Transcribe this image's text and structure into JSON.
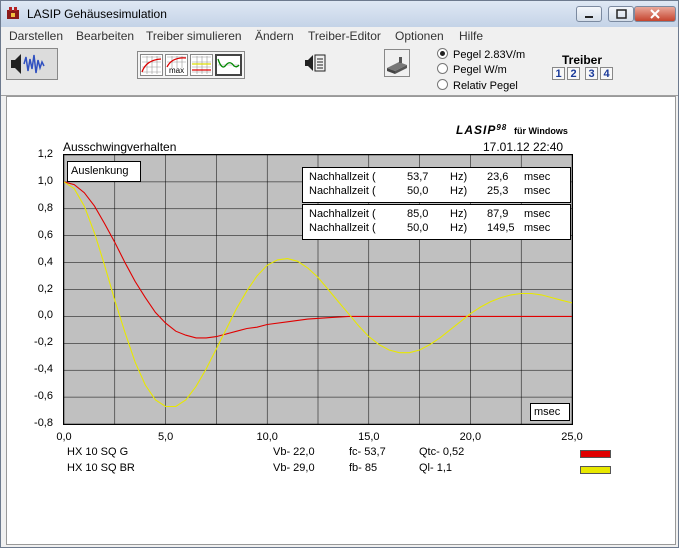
{
  "window": {
    "title": "LASIP  Gehäusesimulation"
  },
  "menu": [
    "Darstellen",
    "Bearbeiten",
    "Treiber simulieren",
    "Ändern",
    "Treiber-Editor",
    "Optionen",
    "Hilfe"
  ],
  "toolbar": {
    "max_label": "max",
    "pegel_options": [
      {
        "label": "Pegel 2.83V/m",
        "selected": true
      },
      {
        "label": "Pegel W/m",
        "selected": false
      },
      {
        "label": "Relativ Pegel",
        "selected": false
      }
    ],
    "treiber_label": "Treiber",
    "treiber_numbers": [
      "1",
      "2",
      "3",
      "4"
    ]
  },
  "header": {
    "logo": "LASIP",
    "logo_version": "98",
    "logo_sub": "für Windows",
    "chart_title": "Ausschwingverhalten",
    "datetime": "17.01.12  22:40"
  },
  "chart_data": {
    "type": "line",
    "title": "Ausschwingverhalten",
    "ylabel": "Auslenkung",
    "xunit": "msec",
    "xlim": [
      0,
      25
    ],
    "ylim": [
      -0.8,
      1.2
    ],
    "xticks": [
      "0,0",
      "5,0",
      "10,0",
      "15,0",
      "20,0",
      "25,0"
    ],
    "yticks": [
      "1,2",
      "1,0",
      "0,8",
      "0,6",
      "0,4",
      "0,2",
      "0,0",
      "-0,2",
      "-0,4",
      "-0,6",
      "-0,8"
    ],
    "grid": true,
    "series": [
      {
        "name": "HX 10 SQ G",
        "color": "#e00000",
        "x": [
          0,
          0.5,
          1,
          1.5,
          2,
          2.5,
          3,
          3.5,
          4,
          4.5,
          5,
          5.5,
          6,
          6.5,
          7,
          7.5,
          8,
          8.5,
          9,
          9.5,
          10,
          11,
          12,
          13,
          14,
          15,
          17,
          19,
          21,
          23,
          25
        ],
        "y": [
          1.0,
          0.98,
          0.92,
          0.82,
          0.69,
          0.55,
          0.4,
          0.26,
          0.14,
          0.03,
          -0.05,
          -0.11,
          -0.14,
          -0.16,
          -0.16,
          -0.15,
          -0.13,
          -0.11,
          -0.09,
          -0.08,
          -0.06,
          -0.04,
          -0.02,
          -0.01,
          0.0,
          0.0,
          0.0,
          0.0,
          0.0,
          0.0,
          0.0
        ]
      },
      {
        "name": "HX 10 SQ BR",
        "color": "#e8e800",
        "x": [
          0,
          0.5,
          1,
          1.5,
          2,
          2.5,
          3,
          3.5,
          4,
          4.5,
          5,
          5.5,
          6,
          6.5,
          7,
          7.5,
          8,
          8.5,
          9,
          9.5,
          10,
          10.5,
          11,
          11.5,
          12,
          12.5,
          13,
          13.5,
          14,
          14.5,
          15,
          15.5,
          16,
          16.5,
          17,
          17.5,
          18,
          18.5,
          19,
          19.5,
          20,
          20.5,
          21,
          21.5,
          22,
          22.5,
          23,
          23.5,
          24,
          24.5,
          25
        ],
        "y": [
          1.0,
          0.95,
          0.82,
          0.62,
          0.38,
          0.12,
          -0.12,
          -0.34,
          -0.51,
          -0.62,
          -0.67,
          -0.67,
          -0.62,
          -0.52,
          -0.39,
          -0.24,
          -0.09,
          0.06,
          0.19,
          0.3,
          0.38,
          0.42,
          0.43,
          0.41,
          0.36,
          0.29,
          0.2,
          0.11,
          0.02,
          -0.07,
          -0.15,
          -0.21,
          -0.25,
          -0.27,
          -0.27,
          -0.25,
          -0.21,
          -0.16,
          -0.1,
          -0.04,
          0.02,
          0.07,
          0.11,
          0.14,
          0.16,
          0.17,
          0.17,
          0.16,
          0.14,
          0.12,
          0.1
        ]
      }
    ]
  },
  "nachhall": [
    {
      "rows": [
        {
          "label": "Nachhallzeit (",
          "freq": "53,7",
          "unit": "Hz)",
          "time": "23,6",
          "tunit": "msec"
        },
        {
          "label": "Nachhallzeit (",
          "freq": "50,0",
          "unit": "Hz)",
          "time": "25,3",
          "tunit": "msec"
        }
      ]
    },
    {
      "rows": [
        {
          "label": "Nachhallzeit (",
          "freq": "85,0",
          "unit": "Hz)",
          "time": "87,9",
          "tunit": "msec"
        },
        {
          "label": "Nachhallzeit (",
          "freq": "50,0",
          "unit": "Hz)",
          "time": "149,5",
          "tunit": "msec"
        }
      ]
    }
  ],
  "legend": [
    {
      "name": "HX 10 SQ G",
      "vb": "Vb- 22,0",
      "f": "fc- 53,7",
      "q": "Qtc- 0,52",
      "color": "#e00000"
    },
    {
      "name": "HX 10 SQ BR",
      "vb": "Vb- 29,0",
      "f": "fb- 85",
      "q": "Ql- 1,1",
      "color": "#e8e800"
    }
  ]
}
